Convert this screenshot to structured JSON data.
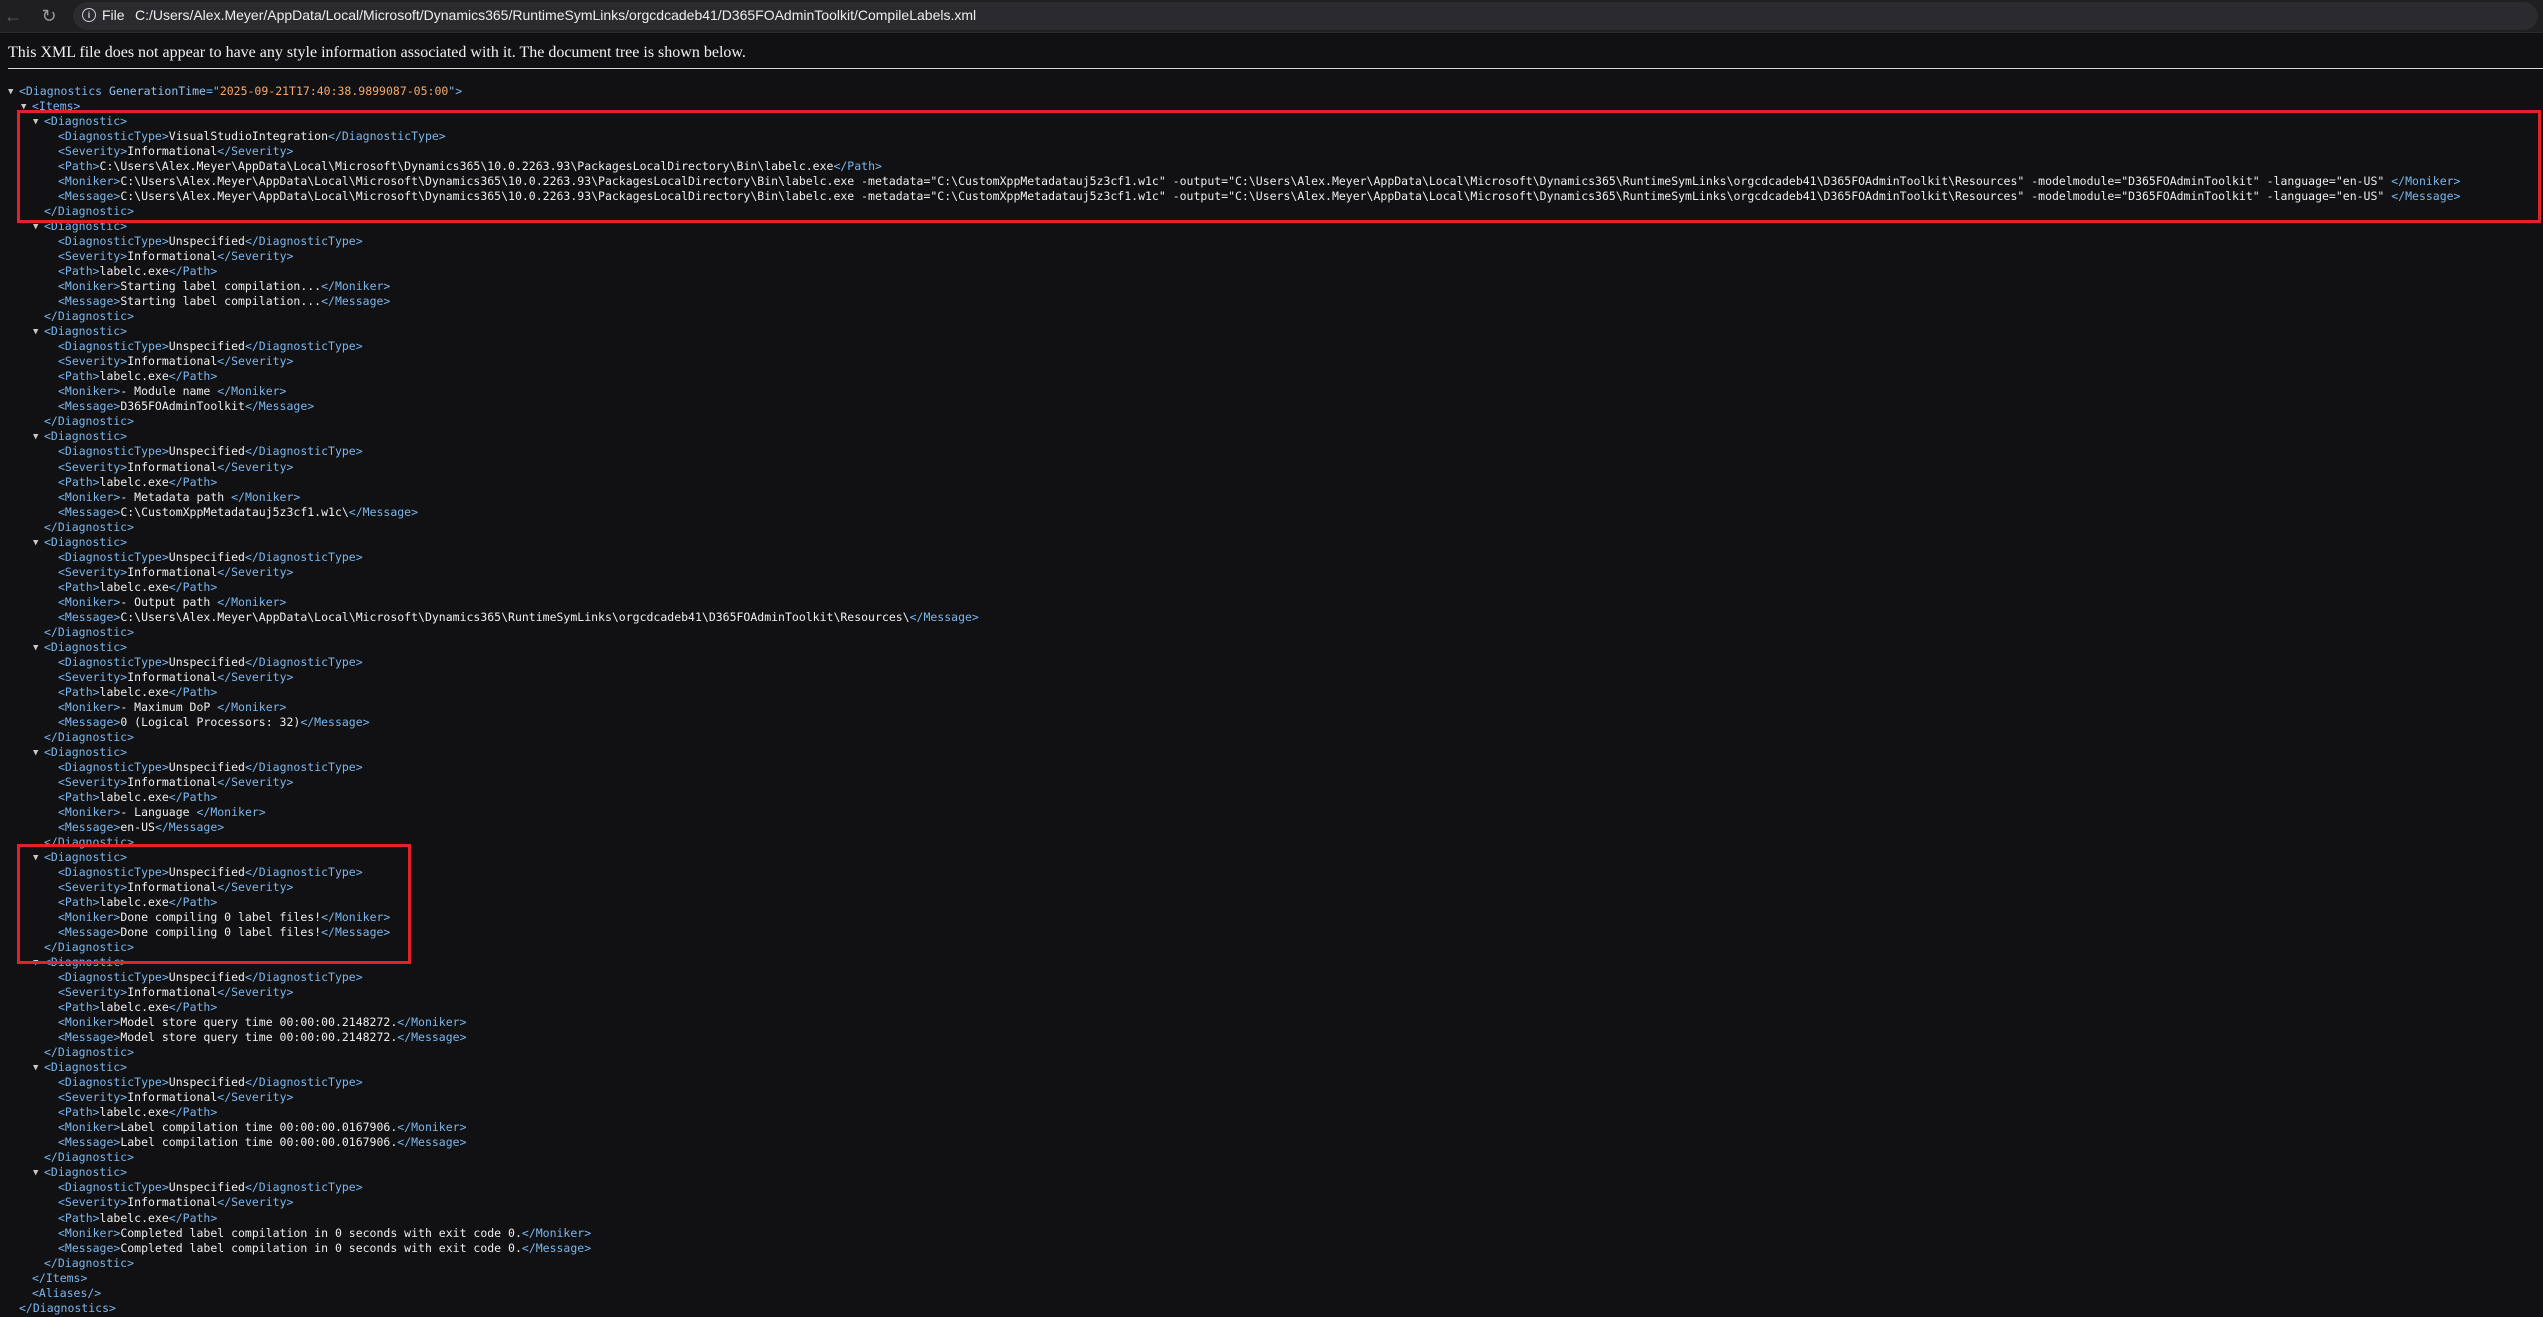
{
  "browser": {
    "file_label": "File",
    "url": "C:/Users/Alex.Meyer/AppData/Local/Microsoft/Dynamics365/RuntimeSymLinks/orgcdcadeb41/D365FOAdminToolkit/CompileLabels.xml"
  },
  "notice": "This XML file does not appear to have any style information associated with it. The document tree is shown below.",
  "root": {
    "open_name": "Diagnostics",
    "attr_name": "GenerationTime",
    "attr_value": "2025-09-21T17:40:38.9899087-05:00",
    "close": "</Diagnostics>"
  },
  "items_open": "<Items>",
  "items_close": "</Items>",
  "aliases": "<Aliases/>",
  "diagnostic_open": "<Diagnostic>",
  "diagnostic_close": "</Diagnostic>",
  "diagnostics": [
    {
      "DiagnosticType": "VisualStudioIntegration",
      "Severity": "Informational",
      "Path": "C:\\Users\\Alex.Meyer\\AppData\\Local\\Microsoft\\Dynamics365\\10.0.2263.93\\PackagesLocalDirectory\\Bin\\labelc.exe",
      "Moniker": "C:\\Users\\Alex.Meyer\\AppData\\Local\\Microsoft\\Dynamics365\\10.0.2263.93\\PackagesLocalDirectory\\Bin\\labelc.exe -metadata=\"C:\\CustomXppMetadatauj5z3cf1.w1c\" -output=\"C:\\Users\\Alex.Meyer\\AppData\\Local\\Microsoft\\Dynamics365\\RuntimeSymLinks\\orgcdcadeb41\\D365FOAdminToolkit\\Resources\" -modelmodule=\"D365FOAdminToolkit\" -language=\"en-US\" ",
      "Message": "C:\\Users\\Alex.Meyer\\AppData\\Local\\Microsoft\\Dynamics365\\10.0.2263.93\\PackagesLocalDirectory\\Bin\\labelc.exe -metadata=\"C:\\CustomXppMetadatauj5z3cf1.w1c\" -output=\"C:\\Users\\Alex.Meyer\\AppData\\Local\\Microsoft\\Dynamics365\\RuntimeSymLinks\\orgcdcadeb41\\D365FOAdminToolkit\\Resources\" -modelmodule=\"D365FOAdminToolkit\" -language=\"en-US\" "
    },
    {
      "DiagnosticType": "Unspecified",
      "Severity": "Informational",
      "Path": "labelc.exe",
      "Moniker": "Starting label compilation...",
      "Message": "Starting label compilation..."
    },
    {
      "DiagnosticType": "Unspecified",
      "Severity": "Informational",
      "Path": "labelc.exe",
      "Moniker": "- Module name ",
      "Message": "D365FOAdminToolkit"
    },
    {
      "DiagnosticType": "Unspecified",
      "Severity": "Informational",
      "Path": "labelc.exe",
      "Moniker": "- Metadata path ",
      "Message": "C:\\CustomXppMetadatauj5z3cf1.w1c\\"
    },
    {
      "DiagnosticType": "Unspecified",
      "Severity": "Informational",
      "Path": "labelc.exe",
      "Moniker": "- Output path ",
      "Message": "C:\\Users\\Alex.Meyer\\AppData\\Local\\Microsoft\\Dynamics365\\RuntimeSymLinks\\orgcdcadeb41\\D365FOAdminToolkit\\Resources\\"
    },
    {
      "DiagnosticType": "Unspecified",
      "Severity": "Informational",
      "Path": "labelc.exe",
      "Moniker": "- Maximum DoP ",
      "Message": "0 (Logical Processors: 32)"
    },
    {
      "DiagnosticType": "Unspecified",
      "Severity": "Informational",
      "Path": "labelc.exe",
      "Moniker": "- Language ",
      "Message": "en-US"
    },
    {
      "DiagnosticType": "Unspecified",
      "Severity": "Informational",
      "Path": "labelc.exe",
      "Moniker": "Done compiling 0 label files!",
      "Message": "Done compiling 0 label files!"
    },
    {
      "DiagnosticType": "Unspecified",
      "Severity": "Informational",
      "Path": "labelc.exe",
      "Moniker": "Model store query time 00:00:00.2148272.",
      "Message": "Model store query time 00:00:00.2148272."
    },
    {
      "DiagnosticType": "Unspecified",
      "Severity": "Informational",
      "Path": "labelc.exe",
      "Moniker": "Label compilation time 00:00:00.0167906.",
      "Message": "Label compilation time 00:00:00.0167906."
    },
    {
      "DiagnosticType": "Unspecified",
      "Severity": "Informational",
      "Path": "labelc.exe",
      "Moniker": "Completed label compilation in 0 seconds with exit code 0.",
      "Message": "Completed label compilation in 0 seconds with exit code 0."
    }
  ],
  "highlight_color": "#e2212b",
  "icons": {
    "back": "back-arrow-icon",
    "reload": "reload-icon",
    "info": "info-icon",
    "collapse": "collapse-triangle-icon"
  }
}
